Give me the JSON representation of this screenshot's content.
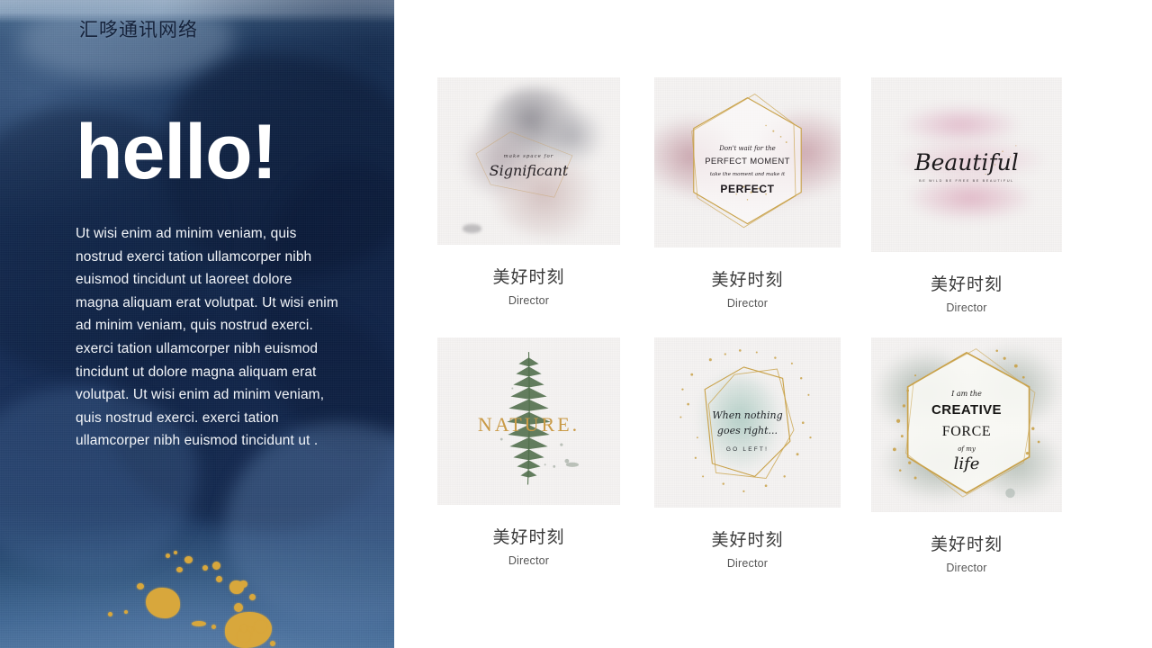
{
  "brand": {
    "title": "汇哆通讯网络"
  },
  "hero": {
    "heading": "hello!",
    "paragraph": "Ut wisi enim ad minim veniam, quis nostrud exerci tation ullamcorper nibh euismod tincidunt ut laoreet dolore magna aliquam erat volutpat. Ut wisi enim ad minim veniam, quis nostrud exerci. exerci tation ullamcorper nibh euismod tincidunt ut  dolore magna aliquam erat volutpat. Ut wisi enim ad minim veniam, quis nostrud exerci. exerci tation ullamcorper nibh euismod tincidunt ut ."
  },
  "theme": {
    "panel_navy": "#1b3460",
    "panel_light_blue": "#9fb3c9",
    "gold_accent": "#d8a73c",
    "gallery_bg": "#ffffff",
    "caption_color": "#3a3a3a",
    "role_color": "#555555"
  },
  "gallery": {
    "cards": [
      {
        "name": "美好时刻",
        "role": "Director",
        "artwork": {
          "id": "significant-watercolor",
          "line1": "make space for",
          "line2": "Significant",
          "palette": [
            "#b9b3b6",
            "#8d8a91",
            "#d8c6c4",
            "#cbbdc0"
          ]
        }
      },
      {
        "name": "美好时刻",
        "role": "Director",
        "artwork": {
          "id": "perfect-moment-hexagon",
          "line1": "Don't wait for the",
          "line2": "PERFECT MOMENT",
          "line3": "take the moment and make it",
          "line4": "PERFECT",
          "palette": [
            "#c9a4ad",
            "#d9b6bd",
            "#c9a06f"
          ]
        }
      },
      {
        "name": "美好时刻",
        "role": "Director",
        "artwork": {
          "id": "beautiful-brushstroke",
          "line1": "Beautiful",
          "line2": "BE WILD BE FREE BE BEAUTIFUL",
          "palette": [
            "#e3bcc9",
            "#dca8bd",
            "#e9cdd6"
          ]
        }
      },
      {
        "name": "美好时刻",
        "role": "Director",
        "artwork": {
          "id": "nature-fern",
          "line1": "NATURE.",
          "palette": [
            "#5c7352",
            "#3f5a3c",
            "#c69b4a"
          ]
        }
      },
      {
        "name": "美好时刻",
        "role": "Director",
        "artwork": {
          "id": "go-left-frame",
          "line1": "When nothing",
          "line2": "goes right...",
          "line3": "GO LEFT!",
          "palette": [
            "#b7cfc6",
            "#a8c5bb",
            "#c9a24a"
          ]
        }
      },
      {
        "name": "美好时刻",
        "role": "Director",
        "artwork": {
          "id": "creative-force-hexagon",
          "line1": "I am the",
          "line2": "CREATIVE",
          "line3": "FORCE",
          "line4": "of my",
          "line5": "life",
          "palette": [
            "#9aa89c",
            "#7e8c84",
            "#c9a24a"
          ]
        }
      }
    ]
  }
}
